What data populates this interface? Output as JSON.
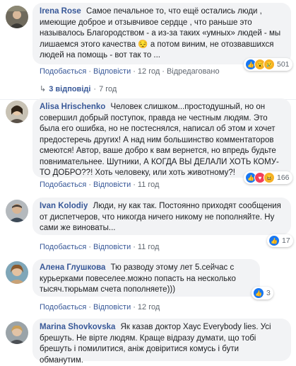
{
  "colors": {
    "author": "#385898",
    "bubble": "#f2f3f5",
    "meta": "#606770"
  },
  "comments": [
    {
      "author": "Irena Rose",
      "text": "Самое печальное то, что ещё остались люди , имеющие доброе и отзывчивое сердце , что раньше это называлось Благородством - а из-за таких «умных» людей - мы лишаемся этого качества 😔 а потом виним, не отозвавшихся людей на помощь - вот так то ...",
      "like": "Подобається",
      "reply": "Відповісти",
      "time": "12 год",
      "edited": "Відредаговано",
      "reactions": [
        "like-icon",
        "wow-icon",
        "sad-icon"
      ],
      "count": "501",
      "replies_label": "3 відповіді",
      "replies_time": "7 год"
    },
    {
      "author": "Alisa Hrischenko",
      "text": "Человек слишком...простодушный, но он совершил добрый поступок, правда не честным людям. Это была его ошибка, но не постеснялся, написал об этом и хочет предостеречь других! А над ним большинство комментаторов смеются! Автор, ваше добро к вам вернется, но впредь будьте повнимательнее. Шутники, А КОГДА ВЫ ДЕЛАЛИ ХОТЬ КОМУ-ТО ДОБРО??! Хоть человеку, или хоть животному?!",
      "like": "Подобається",
      "reply": "Відповісти",
      "time": "11 год",
      "reactions": [
        "like-icon",
        "love-icon",
        "haha-icon"
      ],
      "count": "166"
    },
    {
      "author": "Ivan Kolodiy",
      "text": "Люди, ну как так. Постоянно приходят сообщения от диспетчеров, что никогда ничего никому не пополняйте. Ну сами же виноваты...",
      "like": "Подобається",
      "reply": "Відповісти",
      "time": "11 год",
      "reactions": [
        "like-icon"
      ],
      "count": "17"
    },
    {
      "author": "Алена Глушкова",
      "text": "Тю разводу этому лет 5.сейчас с курьерками повеселее.можно попасть на несколько тысяч.тюрьмам счета пополняете)))",
      "like": "Подобається",
      "reply": "Відповісти",
      "time": "12 год",
      "reactions": [
        "like-icon"
      ],
      "count": "3"
    },
    {
      "author": "Marina Shovkovska",
      "text": "Як казав доктор Хаус Everybody lies. Усі брешуть. Не вірте людям. Краще відразу думати, що тобі брешуть і помилитися, аніж довіритися комусь і бути обманутим."
    }
  ]
}
